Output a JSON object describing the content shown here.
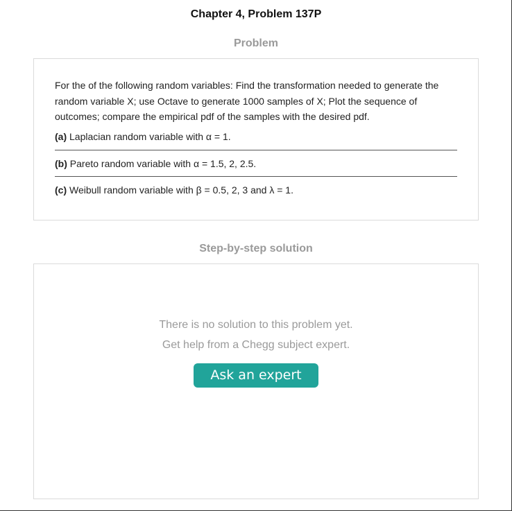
{
  "header": {
    "chapter_title": "Chapter 4, Problem 137P"
  },
  "problem": {
    "heading": "Problem",
    "statement": "For the of the following random variables: Find the transformation needed to generate the random variable X; use Octave to generate 1000 samples of X; Plot the sequence of outcomes; compare the empirical pdf of the samples with the desired pdf.",
    "parts": [
      {
        "label": "(a)",
        "text": "Laplacian random variable with α = 1."
      },
      {
        "label": "(b)",
        "text": "Pareto random variable with α = 1.5, 2, 2.5."
      },
      {
        "label": "(c)",
        "text": "Weibull random variable with β = 0.5, 2, 3 and λ = 1."
      }
    ]
  },
  "solution": {
    "heading": "Step-by-step solution",
    "no_solution_text": "There is no solution to this problem yet.",
    "help_text": "Get help from a Chegg subject expert.",
    "ask_button_label": "Ask an expert",
    "accent_color": "#21a49a"
  }
}
